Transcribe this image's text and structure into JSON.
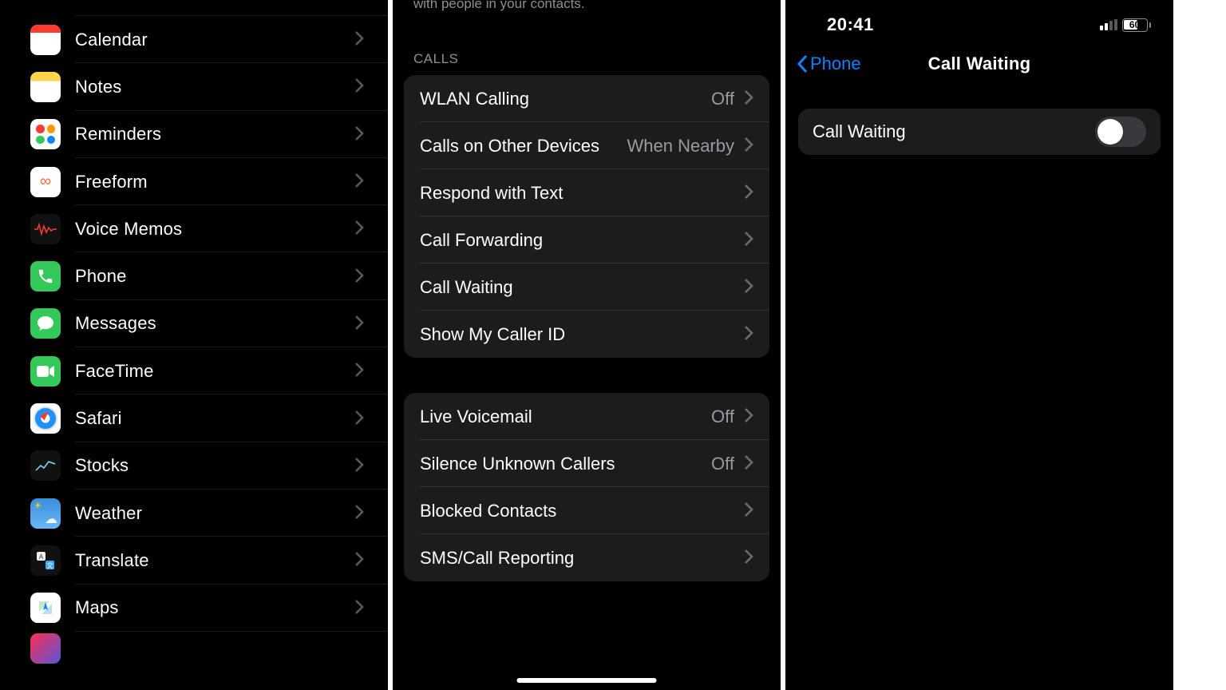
{
  "pane1": {
    "items": [
      {
        "label": "Calendar",
        "icon": "calendar-icon"
      },
      {
        "label": "Notes",
        "icon": "notes-icon"
      },
      {
        "label": "Reminders",
        "icon": "reminders-icon"
      },
      {
        "label": "Freeform",
        "icon": "freeform-icon"
      },
      {
        "label": "Voice Memos",
        "icon": "voice-memos-icon"
      },
      {
        "label": "Phone",
        "icon": "phone-icon"
      },
      {
        "label": "Messages",
        "icon": "messages-icon"
      },
      {
        "label": "FaceTime",
        "icon": "facetime-icon"
      },
      {
        "label": "Safari",
        "icon": "safari-icon"
      },
      {
        "label": "Stocks",
        "icon": "stocks-icon"
      },
      {
        "label": "Weather",
        "icon": "weather-icon"
      },
      {
        "label": "Translate",
        "icon": "translate-icon"
      },
      {
        "label": "Maps",
        "icon": "maps-icon"
      }
    ]
  },
  "pane2": {
    "footer_partial": "with people in your contacts.",
    "section_header": "CALLS",
    "calls": [
      {
        "label": "WLAN Calling",
        "value": "Off"
      },
      {
        "label": "Calls on Other Devices",
        "value": "When Nearby"
      },
      {
        "label": "Respond with Text",
        "value": ""
      },
      {
        "label": "Call Forwarding",
        "value": ""
      },
      {
        "label": "Call Waiting",
        "value": ""
      },
      {
        "label": "Show My Caller ID",
        "value": ""
      }
    ],
    "group2": [
      {
        "label": "Live Voicemail",
        "value": "Off"
      },
      {
        "label": "Silence Unknown Callers",
        "value": "Off"
      },
      {
        "label": "Blocked Contacts",
        "value": ""
      },
      {
        "label": "SMS/Call Reporting",
        "value": ""
      }
    ]
  },
  "pane3": {
    "status_time": "20:41",
    "battery_pct": "60",
    "battery_fill_pct": 60,
    "back_label": "Phone",
    "nav_title": "Call Waiting",
    "toggle_label": "Call Waiting",
    "toggle_on": false
  }
}
